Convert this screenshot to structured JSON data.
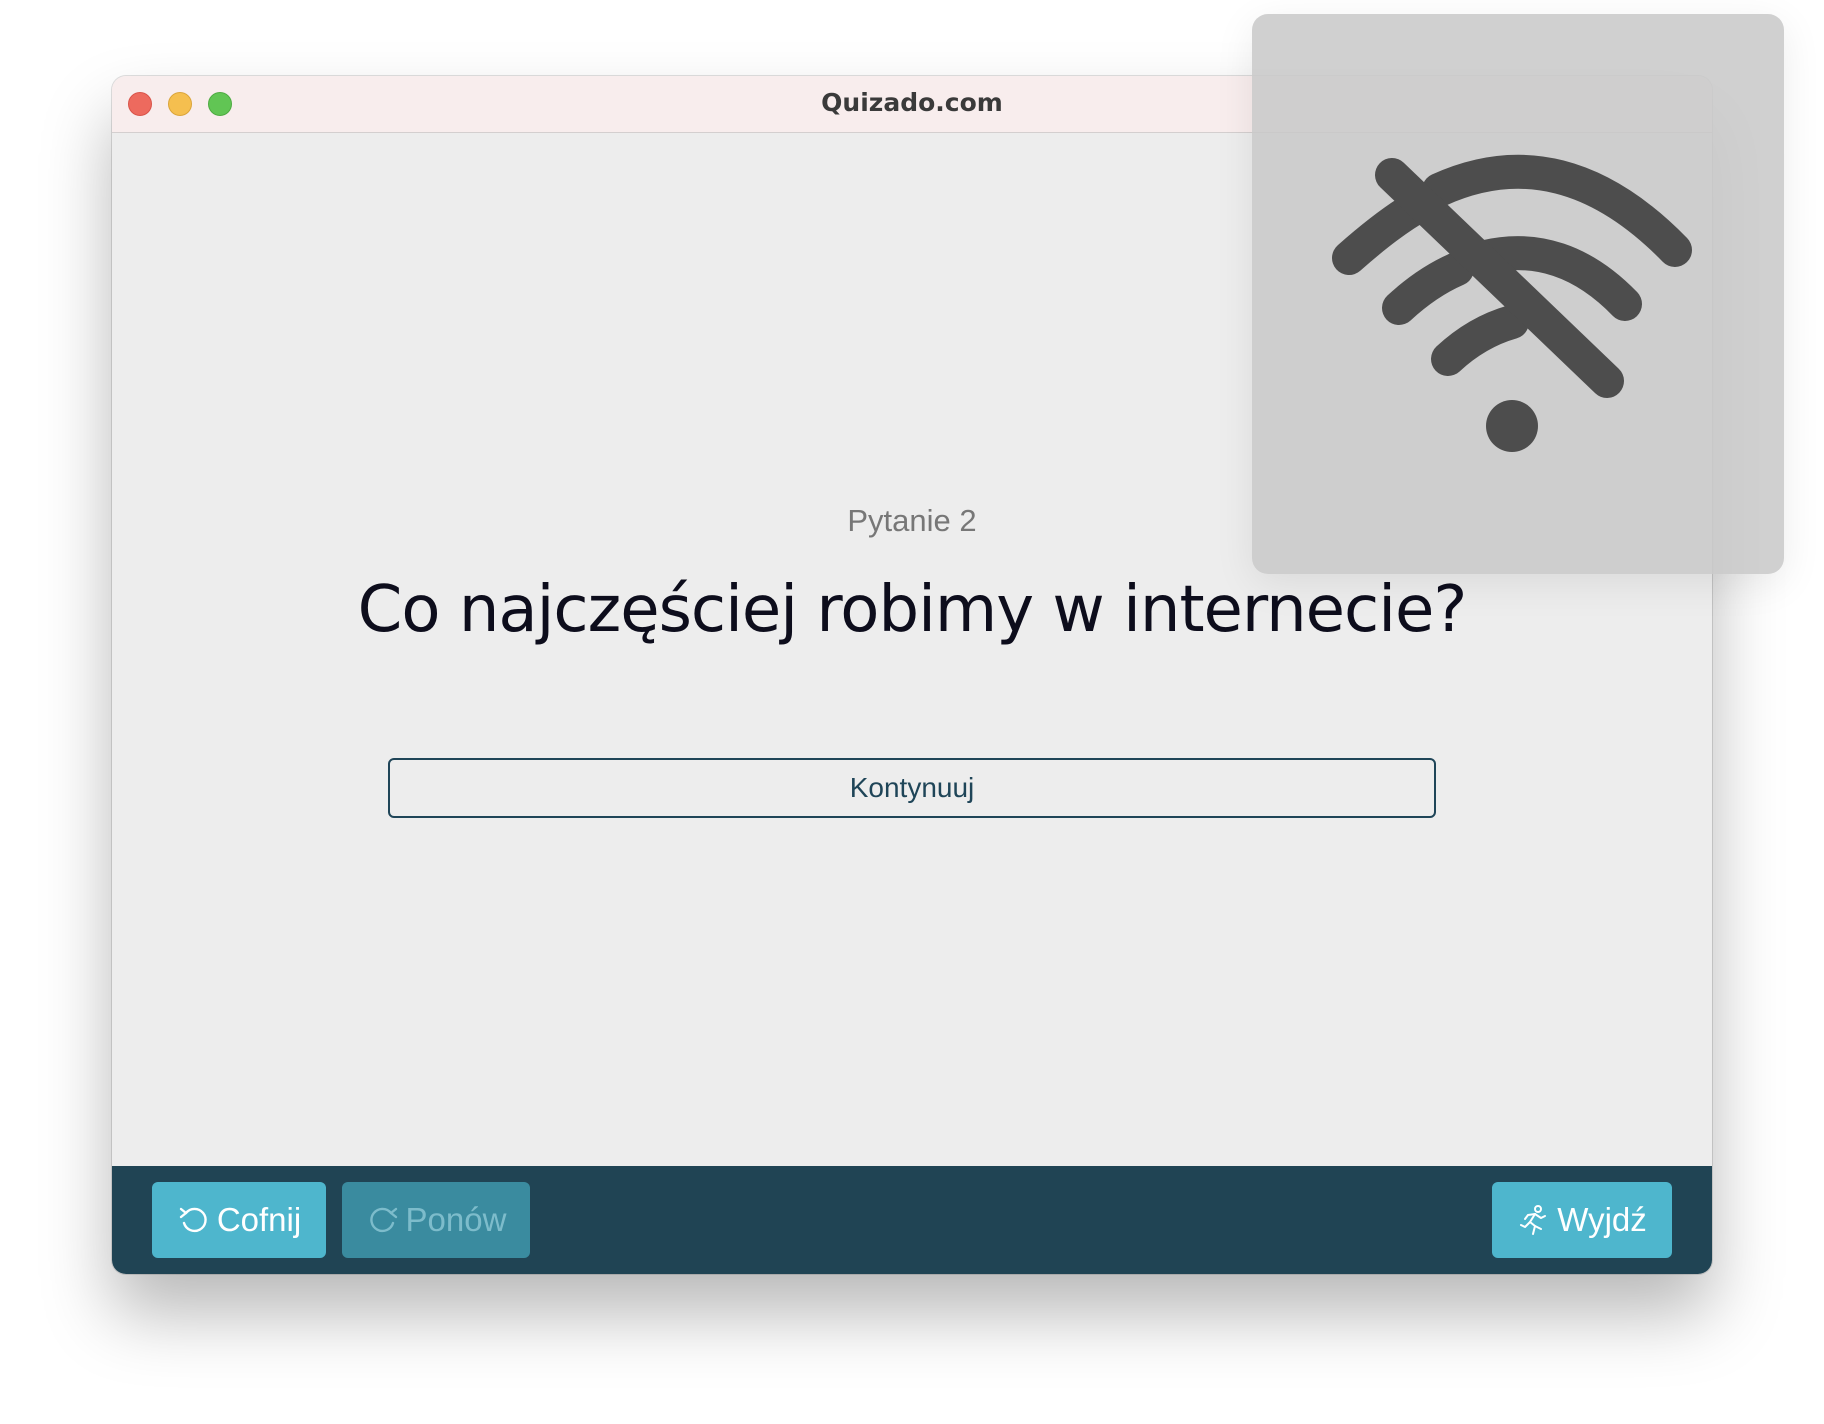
{
  "window": {
    "title": "Quizado.com"
  },
  "quiz": {
    "question_number": "Pytanie 2",
    "question_text": "Co najczęściej robimy w internecie?",
    "continue_label": "Kontynuuj"
  },
  "footer": {
    "undo_label": "Cofnij",
    "redo_label": "Ponów",
    "exit_label": "Wyjdź",
    "redo_disabled": true
  },
  "overlay": {
    "icon": "wifi-off-icon"
  },
  "colors": {
    "footer_bg": "#204454",
    "button_accent": "#4eb6cd",
    "button_disabled": "#3a8b9f",
    "continue_border": "#1f4558",
    "overlay_icon": "#4d4d4d"
  }
}
